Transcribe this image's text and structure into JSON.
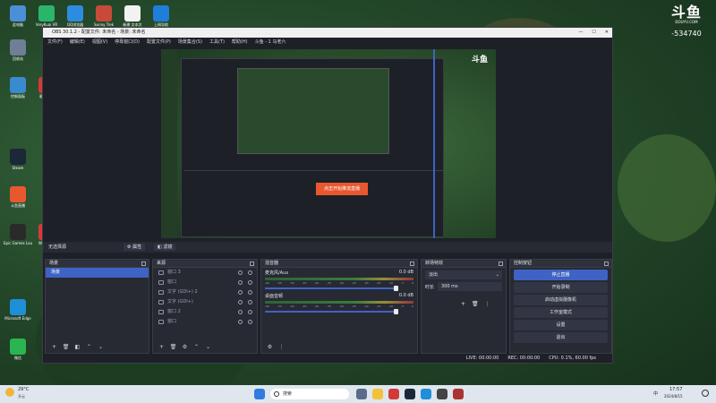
{
  "watermark": {
    "logo": "斗鱼",
    "site": "DOUYU.COM",
    "room": "-534740"
  },
  "desktop_icons": [
    {
      "label": "此电脑",
      "color": "#4b8fd6"
    },
    {
      "label": "VeryKuai VR",
      "color": "#2bb56b"
    },
    {
      "label": "QQ浏览器",
      "color": "#2c8de0"
    },
    {
      "label": "Sunny Trek",
      "color": "#c84a3a"
    },
    {
      "label": "新建 文本文",
      "color": "#f2f2f2"
    },
    {
      "label": "上网导航",
      "color": "#1f7fd8"
    },
    {
      "label": "回收站",
      "color": "#6f7f95"
    },
    {
      "label": "控制面板",
      "color": "#3a8ad0"
    },
    {
      "label": "驱动精灵",
      "color": "#d23a3a"
    },
    {
      "label": "Steam",
      "color": "#1b2838"
    },
    {
      "label": "斗鱼直播",
      "color": "#e8582e"
    },
    {
      "label": "Epic Games Launcher",
      "color": "#2a2a2a"
    },
    {
      "label": "WeGame",
      "color": "#d83a3a"
    },
    {
      "label": "Microsoft Edge",
      "color": "#1f8fd8"
    },
    {
      "label": "微信",
      "color": "#2bb551"
    }
  ],
  "obs": {
    "title": "OBS 30.1.2 - 配置文件: 未命名 - 场景: 未命名",
    "menu": [
      "文件(F)",
      "编辑(E)",
      "视图(V)",
      "停靠窗口(D)",
      "配置文件(P)",
      "场景集合(S)",
      "工具(T)",
      "帮助(H)",
      "斗鱼 - 1 马老六"
    ],
    "source_bar": {
      "label": "无选择源",
      "properties": "属性",
      "filters": "滤镜"
    },
    "scenes": {
      "title": "场景",
      "items": [
        "场景"
      ]
    },
    "sources": {
      "title": "来源",
      "items": [
        "窗口 3",
        "窗口",
        "文字 (GDI+) 2",
        "文字 (GDI+)",
        "窗口 2",
        "窗口"
      ]
    },
    "mixer": {
      "title": "混音器",
      "channels": [
        {
          "name": "麦克风/Aux",
          "db": "0.0 dB"
        },
        {
          "name": "桌面音频",
          "db": "0.0 dB"
        }
      ],
      "scale": [
        "-60",
        "-55",
        "-50",
        "-45",
        "-40",
        "-35",
        "-30",
        "-25",
        "-20",
        "-15",
        "-10",
        "-5",
        "0"
      ]
    },
    "transitions": {
      "title": "转场特效",
      "type": "淡出",
      "duration_label": "时长",
      "duration": "300 ms"
    },
    "controls": {
      "title": "控制按钮",
      "buttons": [
        "停止直播",
        "开始录制",
        "启动虚拟摄像机",
        "工作室模式",
        "设置",
        "退出"
      ]
    },
    "status": {
      "live": "LIVE: 00:00:00",
      "rec": "REC: 00:00:00",
      "cpu": "CPU: 0.1%, 60.00 fps"
    },
    "preview_overlay": "点击开始推流直播"
  },
  "taskbar": {
    "weather_temp": "29°C",
    "weather_desc": "多云",
    "search_placeholder": "搜索",
    "time": "17:57",
    "date": "2024/8/15",
    "lang": "中"
  }
}
